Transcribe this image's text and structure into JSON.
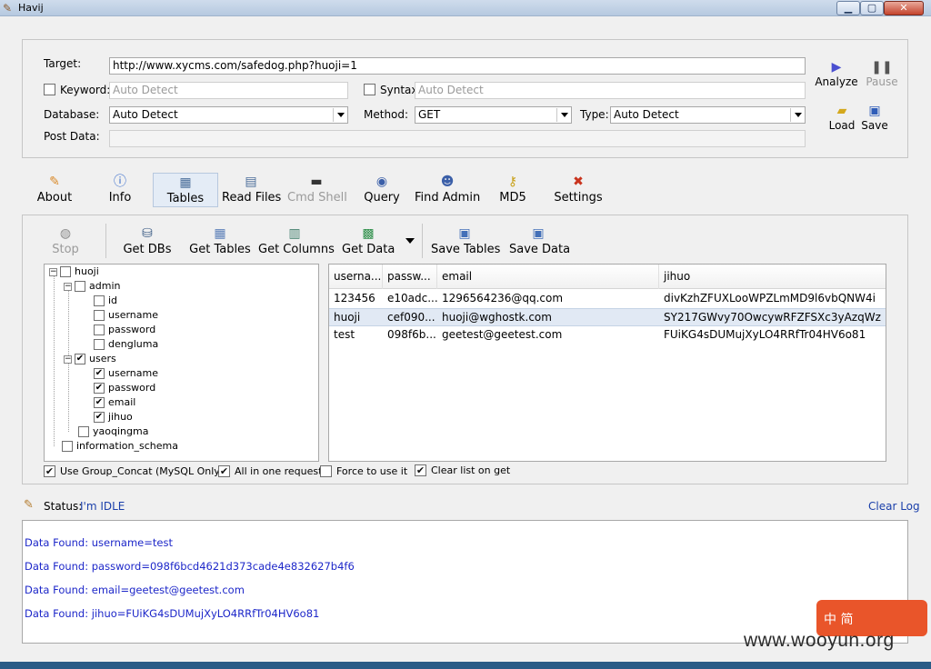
{
  "window": {
    "title": "Havij"
  },
  "target": {
    "target_label": "Target:",
    "target_value": "http://www.xycms.com/safedog.php?huoji=1",
    "keyword_label": "Keyword:",
    "keyword_value": "Auto Detect",
    "syntax_label": "Syntax:",
    "syntax_value": "Auto Detect",
    "database_label": "Database:",
    "database_value": "Auto Detect",
    "method_label": "Method:",
    "method_value": "GET",
    "type_label": "Type:",
    "type_value": "Auto Detect",
    "postdata_label": "Post Data:",
    "postdata_value": ""
  },
  "side_buttons": {
    "analyze": "Analyze",
    "pause": "Pause",
    "load": "Load",
    "save": "Save"
  },
  "tabs": [
    {
      "label": "About",
      "icon": "brush-icon"
    },
    {
      "label": "Info",
      "icon": "info-icon"
    },
    {
      "label": "Tables",
      "icon": "table-icon"
    },
    {
      "label": "Read Files",
      "icon": "file-icon"
    },
    {
      "label": "Cmd Shell",
      "icon": "terminal-icon"
    },
    {
      "label": "Query",
      "icon": "query-icon"
    },
    {
      "label": "Find Admin",
      "icon": "users-icon"
    },
    {
      "label": "MD5",
      "icon": "key-icon"
    },
    {
      "label": "Settings",
      "icon": "tools-icon"
    }
  ],
  "toolbar": {
    "stop": "Stop",
    "get_dbs": "Get DBs",
    "get_tables": "Get Tables",
    "get_columns": "Get Columns",
    "get_data": "Get Data",
    "save_tables": "Save Tables",
    "save_data": "Save Data"
  },
  "tree": {
    "db": "huoji",
    "tables": [
      {
        "name": "admin",
        "checked": false,
        "columns": [
          {
            "name": "id",
            "checked": false
          },
          {
            "name": "username",
            "checked": false
          },
          {
            "name": "password",
            "checked": false
          },
          {
            "name": "dengluma",
            "checked": false
          }
        ]
      },
      {
        "name": "users",
        "checked": true,
        "columns": [
          {
            "name": "username",
            "checked": true
          },
          {
            "name": "password",
            "checked": true
          },
          {
            "name": "email",
            "checked": true
          },
          {
            "name": "jihuo",
            "checked": true
          }
        ]
      },
      {
        "name": "yaoqingma",
        "checked": false,
        "columns": []
      }
    ],
    "other_db": "information_schema"
  },
  "grid": {
    "headers": [
      "userna...",
      "passw...",
      "email",
      "jihuo"
    ],
    "rows": [
      [
        "123456",
        "e10adc...",
        "1296564236@qq.com",
        "divKzhZFUXLooWPZLmMD9l6vbQNW4i"
      ],
      [
        "huoji",
        "cef090...",
        "huoji@wghostk.com",
        "SY217GWvy70OwcywRFZFSXc3yAzqWz"
      ],
      [
        "test",
        "098f6b...",
        "geetest@geetest.com",
        "FUiKG4sDUMujXyLO4RRfTr04HV6o81"
      ]
    ]
  },
  "options": {
    "group_concat": "Use Group_Concat (MySQL Only)",
    "all_in_one": "All in one request.",
    "force": "Force to use it",
    "clear_list": "Clear list on get"
  },
  "status": {
    "label": "Status:",
    "value": "I'm IDLE",
    "clear_log": "Clear Log"
  },
  "log": [
    "Data Found: username=test",
    "Data Found: password=098f6bcd4621d373cade4e832627b4f6",
    "Data Found: email=geetest@geetest.com",
    "Data Found: jihuo=FUiKG4sDUMujXyLO4RRfTr04HV6o81"
  ],
  "watermark": {
    "text": "www.wooyun.org",
    "badge": "中 简"
  }
}
